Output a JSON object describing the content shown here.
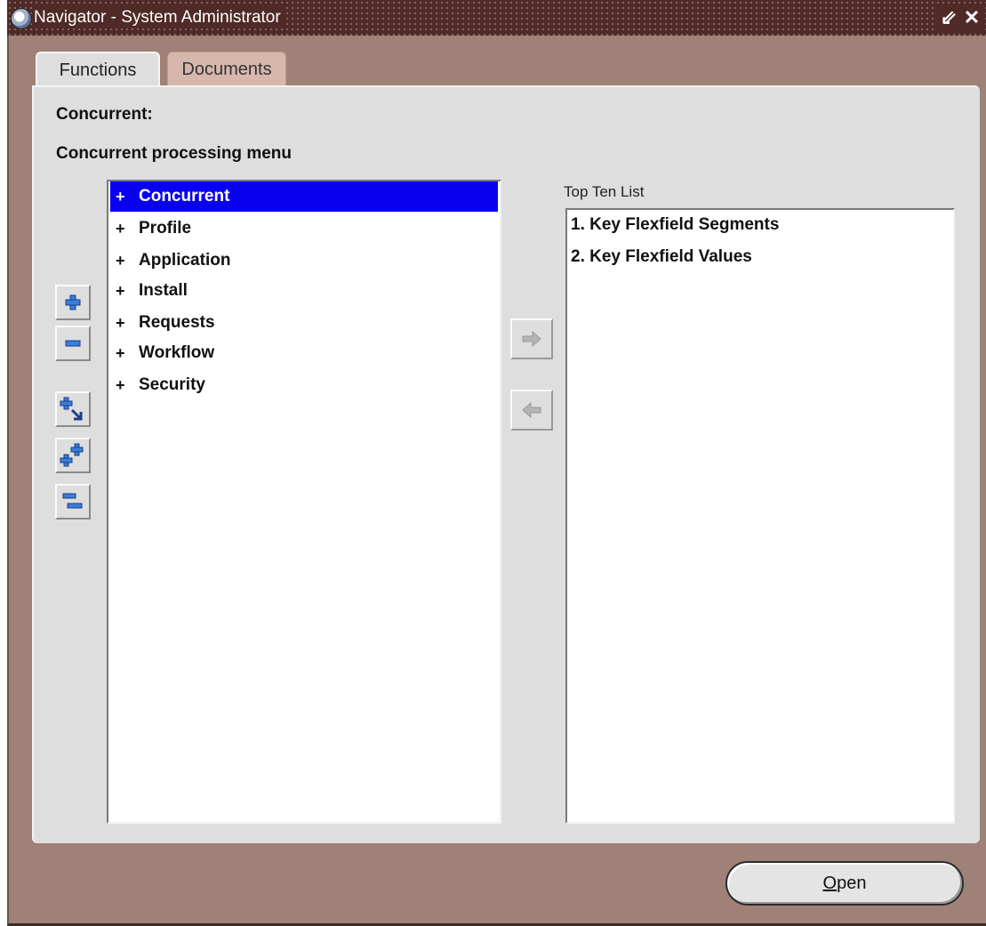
{
  "window": {
    "title": "Navigator - System Administrator",
    "minimize_icon": "minimize-icon",
    "close_icon": "close-icon"
  },
  "tabs": [
    {
      "label": "Functions",
      "active": true
    },
    {
      "label": "Documents",
      "active": false
    }
  ],
  "header": {
    "label": "Concurrent:",
    "description": "Concurrent processing menu"
  },
  "tree": {
    "items": [
      {
        "prefix": "+",
        "label": "Concurrent",
        "selected": true
      },
      {
        "prefix": "+",
        "label": "Profile",
        "selected": false
      },
      {
        "prefix": "+",
        "label": "Application",
        "selected": false
      },
      {
        "prefix": "+",
        "label": "Install",
        "selected": false
      },
      {
        "prefix": "+",
        "label": "Requests",
        "selected": false
      },
      {
        "prefix": "+",
        "label": "Workflow",
        "selected": false
      },
      {
        "prefix": "+",
        "label": "Security",
        "selected": false
      }
    ]
  },
  "top_ten": {
    "label": "Top Ten List",
    "items": [
      "1. Key Flexfield Segments",
      "2. Key Flexfield Values"
    ]
  },
  "toolbar": {
    "icons": [
      "expand-icon",
      "collapse-icon",
      "expand-branch-icon",
      "expand-all-icon",
      "collapse-all-icon"
    ]
  },
  "buttons": {
    "add_icon": "right-arrow-icon",
    "remove_icon": "left-arrow-icon",
    "open_mnemonic": "O",
    "open_rest": "pen"
  },
  "colors": {
    "selection": "#0a00f0",
    "frame": "#9f8177",
    "panel": "#dedede",
    "titlebar": "#4f2a27"
  }
}
